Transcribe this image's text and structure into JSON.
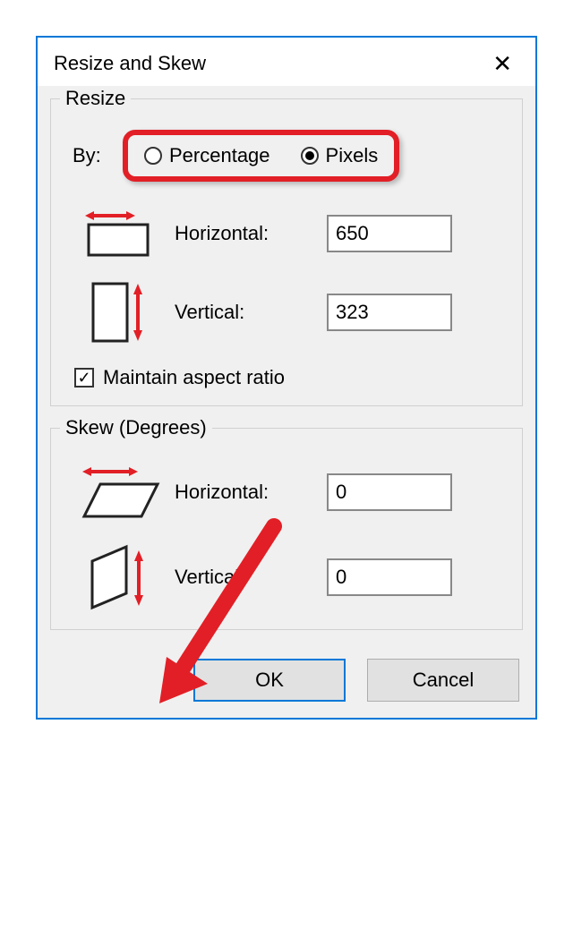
{
  "title": "Resize and Skew",
  "resize": {
    "legend": "Resize",
    "by_label": "By:",
    "radio_percentage": "Percentage",
    "radio_pixels": "Pixels",
    "selected_unit": "pixels",
    "horizontal_label": "Horizontal:",
    "horizontal_value": "650",
    "vertical_label": "Vertical:",
    "vertical_value": "323",
    "maintain_aspect_label": "Maintain aspect ratio",
    "maintain_aspect_checked": true
  },
  "skew": {
    "legend": "Skew (Degrees)",
    "horizontal_label": "Horizontal:",
    "horizontal_value": "0",
    "vertical_label": "Vertical:",
    "vertical_value": "0"
  },
  "buttons": {
    "ok": "OK",
    "cancel": "Cancel"
  },
  "annotations": {
    "highlight_radio_group": true,
    "arrow_to_ok": true
  }
}
